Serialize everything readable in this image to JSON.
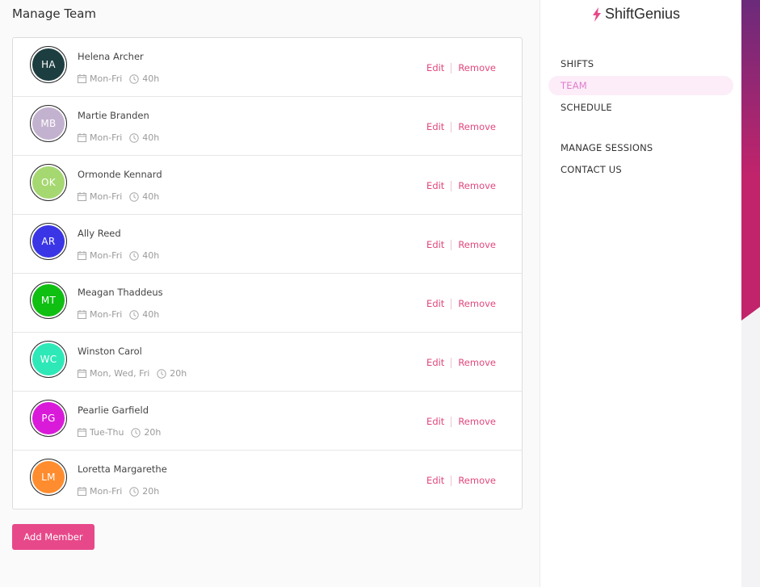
{
  "page": {
    "title": "Manage Team"
  },
  "members": [
    {
      "initials": "HA",
      "name": "Helena Archer",
      "days": "Mon-Fri",
      "hours": "40h",
      "color": "#1d3e41"
    },
    {
      "initials": "MB",
      "name": "Martie Branden",
      "days": "Mon-Fri",
      "hours": "40h",
      "color": "#c3b2cf"
    },
    {
      "initials": "OK",
      "name": "Ormonde Kennard",
      "days": "Mon-Fri",
      "hours": "40h",
      "color": "#a5d871"
    },
    {
      "initials": "AR",
      "name": "Ally Reed",
      "days": "Mon-Fri",
      "hours": "40h",
      "color": "#3a36e6"
    },
    {
      "initials": "MT",
      "name": "Meagan Thaddeus",
      "days": "Mon-Fri",
      "hours": "40h",
      "color": "#0fbf12"
    },
    {
      "initials": "WC",
      "name": "Winston Carol",
      "days": "Mon, Wed, Fri",
      "hours": "20h",
      "color": "#2ee8b8"
    },
    {
      "initials": "PG",
      "name": "Pearlie Garfield",
      "days": "Tue-Thu",
      "hours": "20h",
      "color": "#d91bd9"
    },
    {
      "initials": "LM",
      "name": "Loretta Margarethe",
      "days": "Mon-Fri",
      "hours": "20h",
      "color": "#ff8c2e"
    }
  ],
  "actions": {
    "edit": "Edit",
    "remove": "Remove"
  },
  "add_member_label": "Add Member",
  "brand": {
    "name": "ShiftGenius",
    "icon": "bolt-icon"
  },
  "nav": {
    "shifts": "SHIFTS",
    "team": "TEAM",
    "schedule": "SCHEDULE",
    "manage_sessions": "MANAGE SESSIONS",
    "contact_us": "CONTACT US",
    "active": "team"
  },
  "theme": {
    "accent": "#e7488a",
    "active_nav_text": "#e07dcd",
    "active_nav_bg": "#fcedf8",
    "deco_gradient": [
      "#6b2a7a",
      "#c1246b"
    ]
  }
}
